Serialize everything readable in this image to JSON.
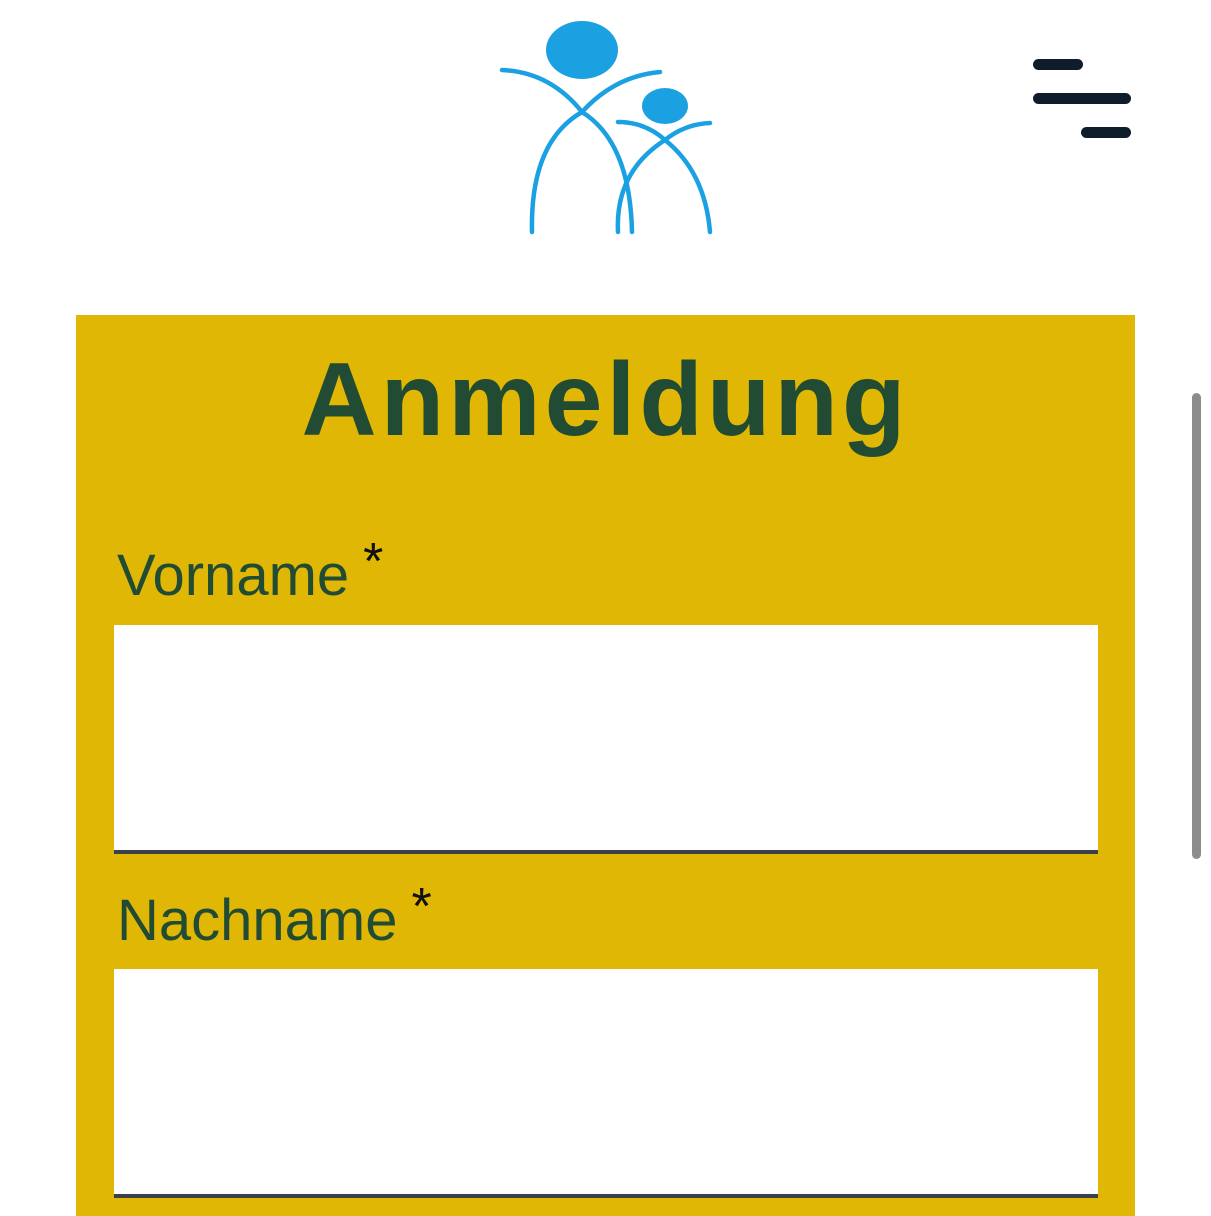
{
  "header": {
    "logo_icon": "parent-child-figures-logo-icon",
    "menu_icon": "hamburger-menu-icon",
    "logo_color": "#1ba1e2",
    "menu_color": "#0f1c2b"
  },
  "form": {
    "title": "Anmeldung",
    "background_color": "#e1b706",
    "text_color": "#214c33",
    "fields": [
      {
        "label": "Vorname",
        "required_marker": "*",
        "value": "",
        "placeholder": ""
      },
      {
        "label": "Nachname",
        "required_marker": "*",
        "value": "",
        "placeholder": ""
      }
    ]
  }
}
